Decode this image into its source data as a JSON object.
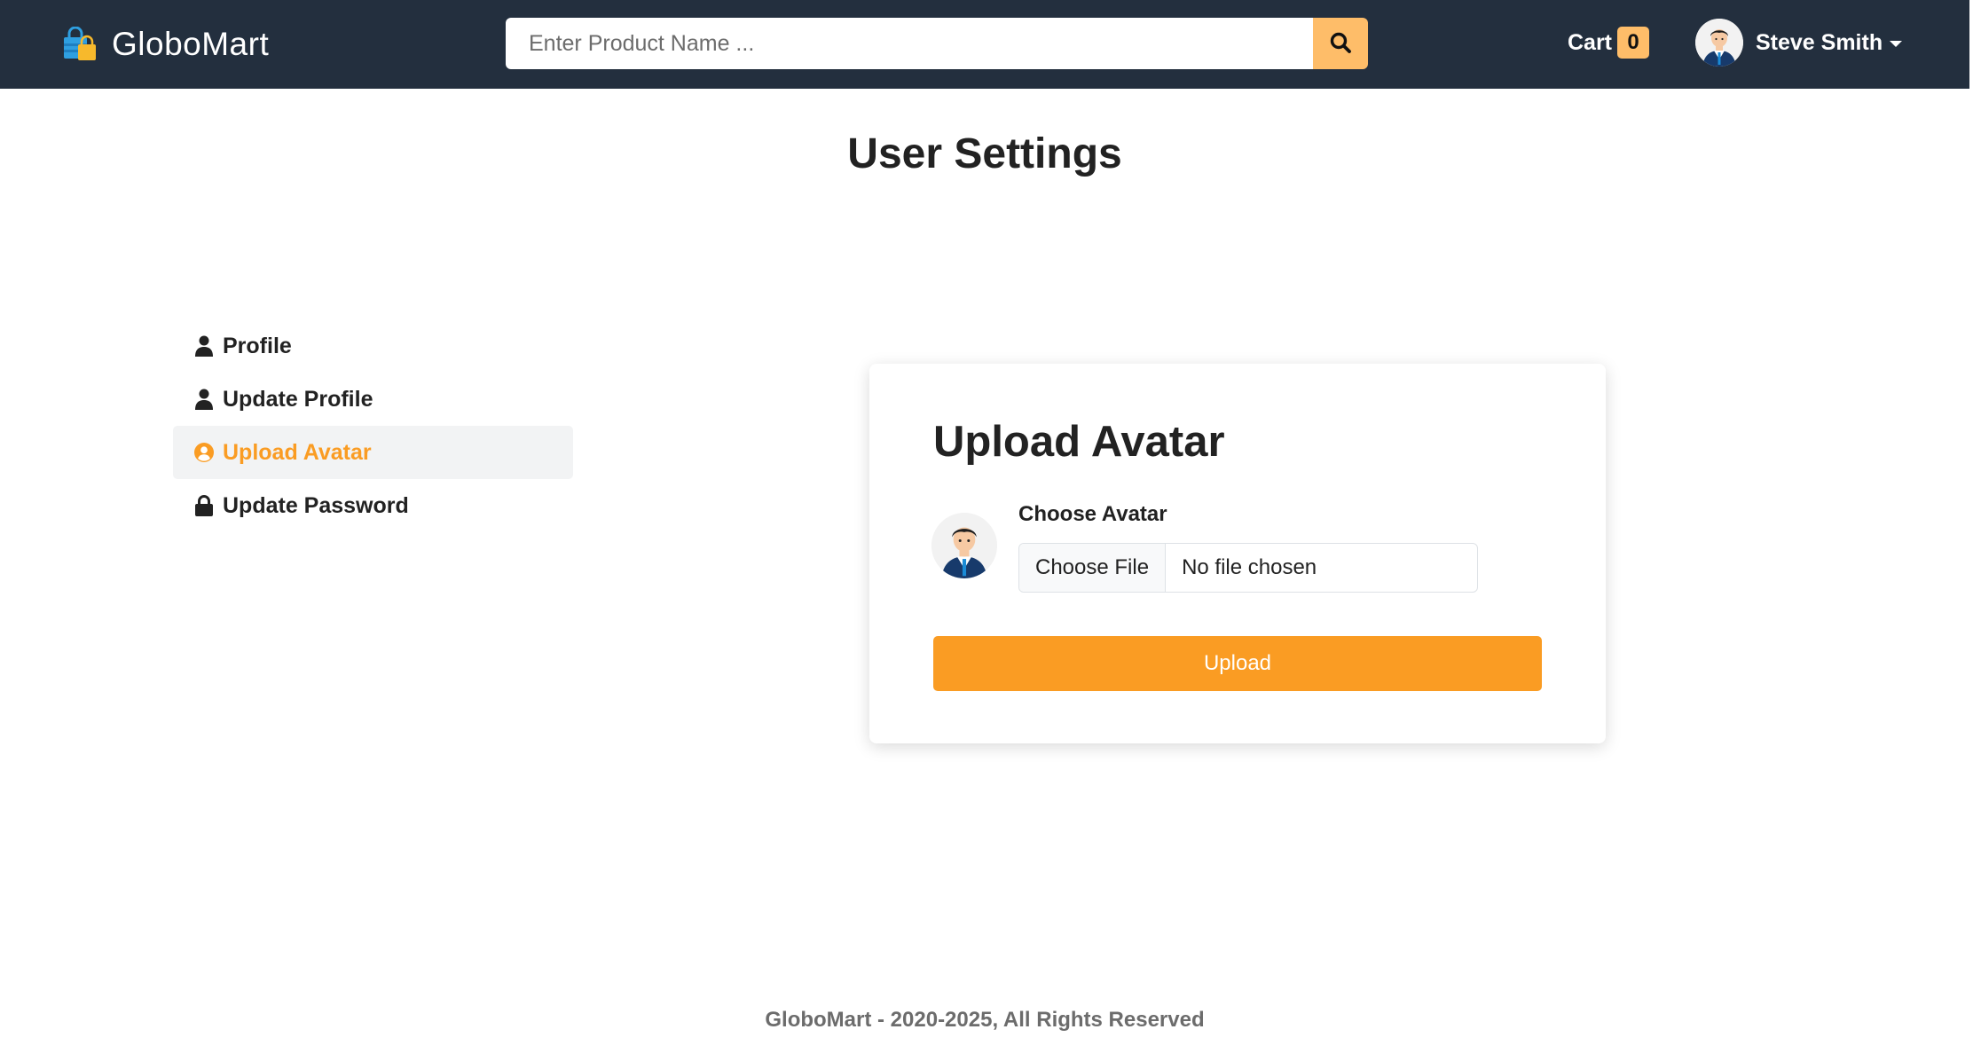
{
  "brand": {
    "name": "GloboMart"
  },
  "search": {
    "placeholder": "Enter Product Name ..."
  },
  "cart": {
    "label": "Cart",
    "count": "0"
  },
  "user": {
    "name": "Steve Smith"
  },
  "page": {
    "title": "User Settings"
  },
  "sidebar": {
    "items": [
      {
        "label": "Profile",
        "icon": "user-icon",
        "active": false
      },
      {
        "label": "Update Profile",
        "icon": "user-icon",
        "active": false
      },
      {
        "label": "Upload Avatar",
        "icon": "user-circle-icon",
        "active": true
      },
      {
        "label": "Update Password",
        "icon": "lock-icon",
        "active": false
      }
    ]
  },
  "card": {
    "title": "Upload Avatar",
    "choose_label": "Choose Avatar",
    "file_button": "Choose File",
    "file_status": "No file chosen",
    "upload_label": "Upload"
  },
  "footer": {
    "text": "GloboMart - 2020-2025, All Rights Reserved"
  },
  "colors": {
    "navbar": "#232f3e",
    "accent": "#febd69",
    "primary": "#fa9c23",
    "sidebar_active_bg": "#f2f3f4"
  }
}
